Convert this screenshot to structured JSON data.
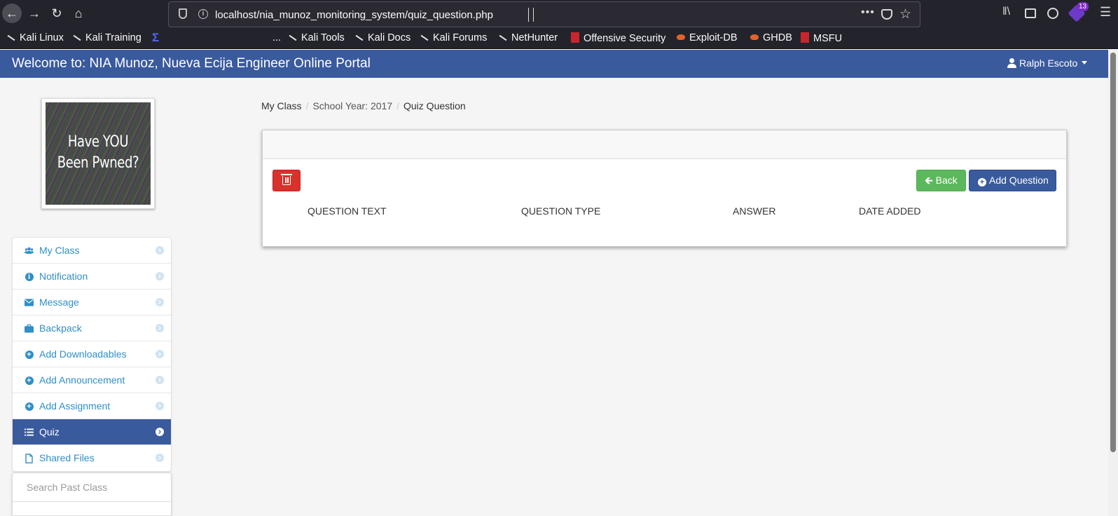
{
  "browser": {
    "url": "localhost/nia_munoz_monitoring_system/quiz_question.php",
    "ext_badge": "13",
    "bookmarks": [
      "Kali Linux",
      "Kali Training",
      "...",
      "Kali Tools",
      "Kali Docs",
      "Kali Forums",
      "NetHunter",
      "Offensive Security",
      "Exploit-DB",
      "GHDB",
      "MSFU"
    ]
  },
  "header": {
    "title": "Welcome to: NIA Munoz, Nueva Ecija Engineer Online Portal",
    "user": "Ralph Escoto",
    "color": "#3a5a9e"
  },
  "banner": {
    "line1": "Have YOU",
    "line2": "Been Pwned?"
  },
  "sidebar": {
    "items": [
      {
        "label": "My Class",
        "icon": "users-icon"
      },
      {
        "label": "Notification",
        "icon": "info-circle-icon"
      },
      {
        "label": "Message",
        "icon": "envelope-icon"
      },
      {
        "label": "Backpack",
        "icon": "briefcase-icon"
      },
      {
        "label": "Add Downloadables",
        "icon": "plus-circle-icon"
      },
      {
        "label": "Add Announcement",
        "icon": "plus-circle-icon"
      },
      {
        "label": "Add Assignment",
        "icon": "plus-circle-icon"
      },
      {
        "label": "Quiz",
        "icon": "list-icon",
        "active": true
      },
      {
        "label": "Shared Files",
        "icon": "file-icon"
      }
    ],
    "search_placeholder": "Search Past Class"
  },
  "breadcrumb": {
    "my_class": "My Class",
    "school_year": "School Year: 2017",
    "current": "Quiz Question"
  },
  "panel": {
    "back_label": "Back",
    "add_label": "Add Question",
    "columns": [
      "QUESTION TEXT",
      "QUESTION TYPE",
      "ANSWER",
      "DATE ADDED"
    ]
  }
}
